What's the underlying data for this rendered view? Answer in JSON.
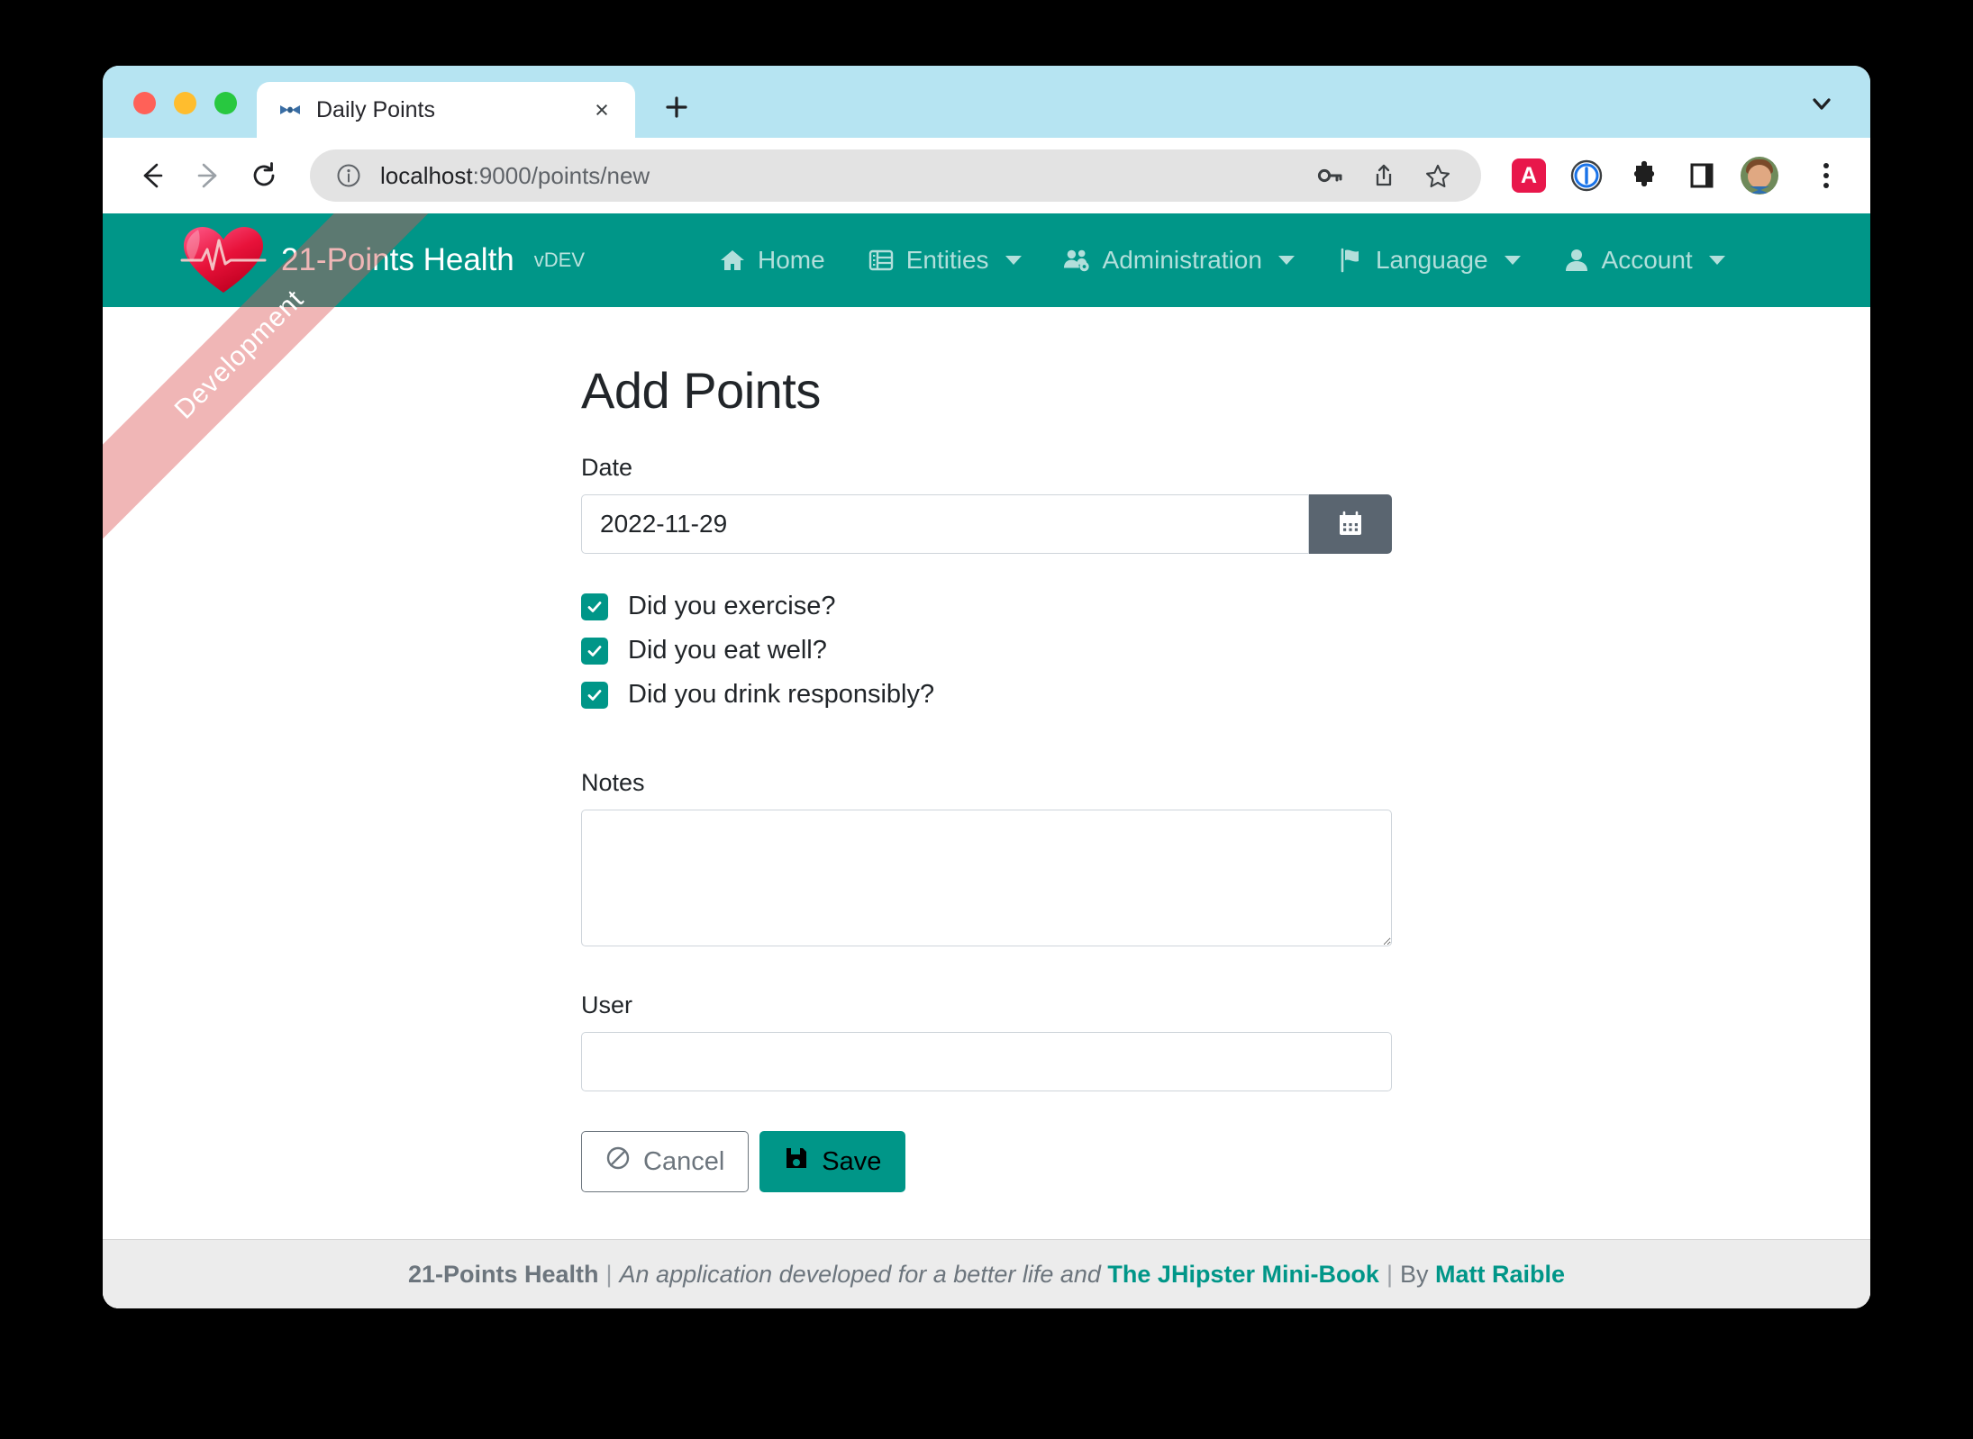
{
  "browser": {
    "tab": {
      "title": "Daily Points",
      "favicon": "jhipster-bowtie-icon",
      "close": "×"
    },
    "new_tab_label": "+",
    "tabstrip_chevron": "chevron-down-icon",
    "toolbar": {
      "back": "←",
      "forward": "→",
      "reload": "⟳",
      "info_icon": "info-circle-icon",
      "url_host": "localhost",
      "url_path": ":9000/points/new",
      "url_full": "localhost:9000/points/new",
      "key_icon": "key-icon",
      "share_icon": "share-icon",
      "bookmark_icon": "star-icon",
      "ext_a_label": "A",
      "ext_onepassword": "1password-icon",
      "ext_puzzle": "extensions-puzzle-icon",
      "ext_sidebar": "side-panel-icon",
      "profile": "avatar",
      "menu": "kebab-menu-icon"
    }
  },
  "navbar": {
    "brand_name": "21-Points Health",
    "brand_version": "vDEV",
    "items": [
      {
        "label": "Home",
        "icon": "home-icon",
        "caret": false
      },
      {
        "label": "Entities",
        "icon": "table-list-icon",
        "caret": true
      },
      {
        "label": "Administration",
        "icon": "users-cog-icon",
        "caret": true
      },
      {
        "label": "Language",
        "icon": "flag-icon",
        "caret": true
      },
      {
        "label": "Account",
        "icon": "user-icon",
        "caret": true
      }
    ]
  },
  "ribbon": {
    "label": "Development"
  },
  "form": {
    "title": "Add Points",
    "date": {
      "label": "Date",
      "value": "2022-11-29",
      "placeholder": "",
      "calendar_icon": "calendar-icon"
    },
    "checkboxes": [
      {
        "label": "Did you exercise?",
        "checked": true
      },
      {
        "label": "Did you eat well?",
        "checked": true
      },
      {
        "label": "Did you drink responsibly?",
        "checked": true
      }
    ],
    "notes": {
      "label": "Notes",
      "value": "",
      "placeholder": ""
    },
    "user": {
      "label": "User",
      "value": "",
      "placeholder": ""
    },
    "buttons": {
      "cancel": "Cancel",
      "cancel_icon": "ban-icon",
      "save": "Save",
      "save_icon": "floppy-disk-icon"
    }
  },
  "footer": {
    "brand": "21-Points Health",
    "sep1": "|",
    "tagline": "An application developed for a better life and",
    "book_link": "The JHipster Mini-Book",
    "sep2": "|",
    "by": "By",
    "author_link": "Matt Raible"
  },
  "colors": {
    "navbar_teal": "#009688",
    "tabstrip_blue": "#b6e4f2",
    "accent": "#009688",
    "ribbon": "#dc5050"
  }
}
